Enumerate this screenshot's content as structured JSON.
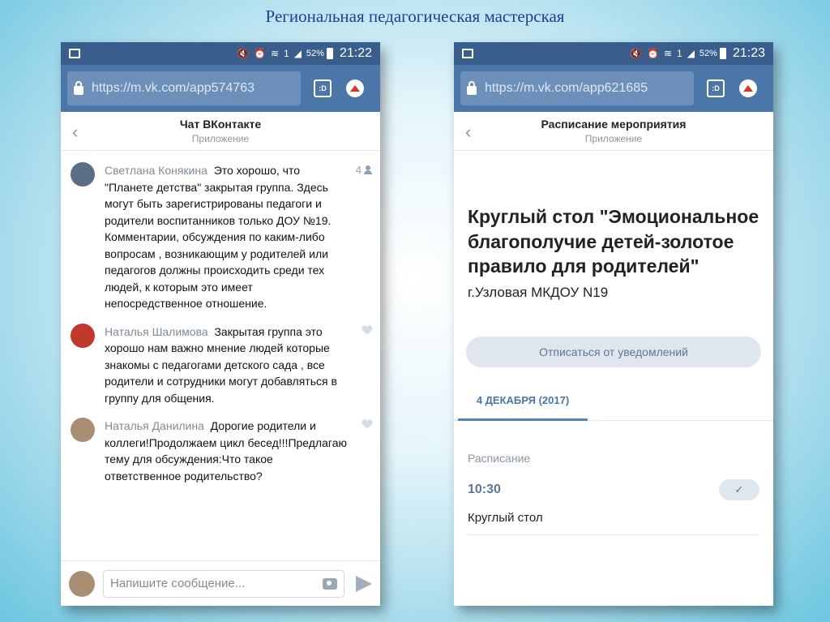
{
  "slide": {
    "title": "Региональная педагогическая мастерская"
  },
  "left_phone": {
    "status": {
      "battery": "52%",
      "time": "21:22"
    },
    "url": "https://m.vk.com/app574763",
    "header": {
      "title": "Чат ВКонтакте",
      "subtitle": "Приложение"
    },
    "messages": [
      {
        "author": "Светлана Конякина",
        "text": "Это хорошо, что \"Планете детства\" закрытая группа. Здесь могут быть зарегистрированы педагоги и родители воспитанников только ДОУ №19. Комментарии, обсуждения по каким-либо вопросам , возникающим у родителей или педагогов должны происходить среди тех людей, к которым это имеет непосредственное отношение.",
        "likes": "4",
        "avatar_color": "#5a6f86"
      },
      {
        "author": "Наталья Шалимова",
        "text": "Закрытая группа это хорошо нам важно мнение людей которые знакомы с педагогами детского сада , все родители и сотрудники могут добавляться в группу для общения.",
        "avatar_color": "#c0392b"
      },
      {
        "author": "Наталья Данилина",
        "text": "Дорогие родители и коллеги!Продолжаем цикл бесед!!!Предлагаю тему для обсуждения:Что такое ответственное родительство?",
        "avatar_color": "#a88f74"
      }
    ],
    "composer": {
      "placeholder": "Напишите сообщение..."
    }
  },
  "right_phone": {
    "status": {
      "battery": "52%",
      "time": "21:23"
    },
    "url": "https://m.vk.com/app621685",
    "header": {
      "title": "Расписание мероприятия",
      "subtitle": "Приложение"
    },
    "event": {
      "title": "Круглый стол \"Эмоциональное благополучие детей-золотое правило для родителей\"",
      "place": "г.Узловая МКДОУ N19",
      "unsubscribe_label": "Отписаться от уведомлений",
      "date_tab": "4 ДЕКАБРЯ (2017)",
      "schedule_label": "Расписание",
      "schedule_time": "10:30",
      "schedule_item": "Круглый стол",
      "check_glyph": "✓"
    }
  },
  "icons": {
    "back": "‹",
    "tabs": ":D",
    "mute": "🔇",
    "alarm": "⏰",
    "wifi": "≋",
    "sim": "1",
    "signal": "◢"
  },
  "colors": {
    "vk_blue": "#4a76a8",
    "status_bar": "#3a5e8c",
    "accent_red": "#d9352a"
  }
}
